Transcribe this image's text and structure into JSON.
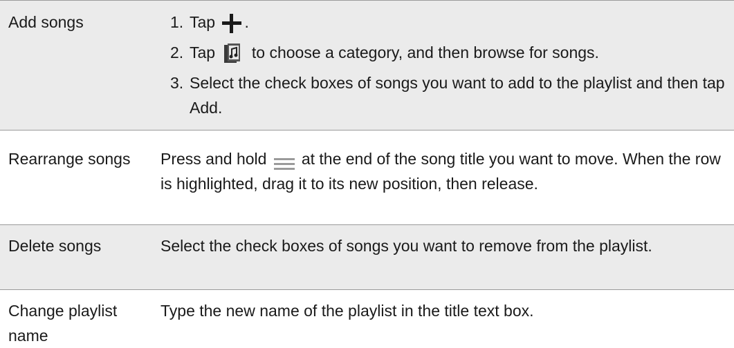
{
  "rows": [
    {
      "label": "Add songs",
      "steps": [
        {
          "num": "1.",
          "before": "Tap",
          "after": "."
        },
        {
          "num": "2.",
          "before": "Tap",
          "after": "to choose a category, and then browse for songs."
        },
        {
          "num": "3.",
          "text": "Select the check boxes of songs you want to add to the playlist and then tap",
          "emph": "Add",
          "end": "."
        }
      ]
    },
    {
      "label": "Rearrange songs",
      "before": "Press and hold",
      "after": "at the end of the song title you want to move. When the row is highlighted, drag it to its new position, then release."
    },
    {
      "label": "Delete songs",
      "text": "Select the check boxes of songs you want to remove from the playlist."
    },
    {
      "label": "Change playlist name",
      "text": "Type the new name of the playlist in the title text box."
    }
  ],
  "icons": {
    "add": "plus-icon",
    "category": "music-library-icon",
    "drag": "drag-handle-icon"
  },
  "colors": {
    "shaded_row": "#ebebeb",
    "border": "#9a9a9a",
    "text": "#1a1a1a"
  }
}
